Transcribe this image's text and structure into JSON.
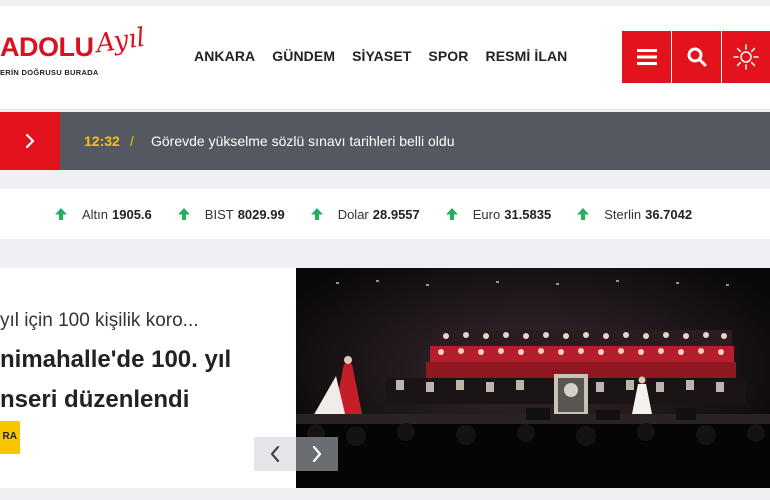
{
  "header": {
    "logo_main": "ADOLU",
    "logo_script": "Ayıl",
    "logo_tagline": "ERİN DOĞRUSU BURADA",
    "nav": [
      "ANKARA",
      "GÜNDEM",
      "SİYASET",
      "SPOR",
      "RESMİ İLAN"
    ],
    "buttons": {
      "menu": "menu-icon",
      "search": "search-icon",
      "theme": "sun-icon"
    }
  },
  "breaking": {
    "time": "12:32",
    "separator": "/",
    "text": "Görevde yükselme sözlü sınavı tarihleri belli oldu"
  },
  "markets": [
    {
      "name": "Altın",
      "value": "1905.6",
      "trend": "up"
    },
    {
      "name": "BIST",
      "value": "8029.99",
      "trend": "up"
    },
    {
      "name": "Dolar",
      "value": "28.9557",
      "trend": "up"
    },
    {
      "name": "Euro",
      "value": "31.5835",
      "trend": "up"
    },
    {
      "name": "Sterlin",
      "value": "36.7042",
      "trend": "up"
    }
  ],
  "slider": {
    "subtitle": "yıl için 100 kişilik koro...",
    "title_line1": "nimahalle'de 100. yıl",
    "title_line2": "nseri düzenlendi",
    "badge": "RA"
  },
  "colors": {
    "brand_red": "#e3131d",
    "breaking_bg": "#54585f",
    "time_yellow": "#f1c40f",
    "trend_green": "#27ae60",
    "badge_yellow": "#f7c600"
  }
}
